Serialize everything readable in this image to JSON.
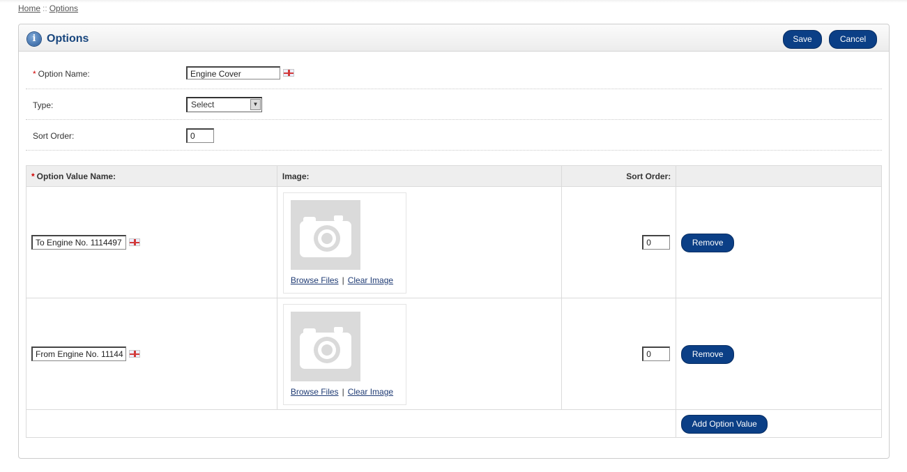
{
  "breadcrumb": {
    "home": "Home",
    "separator": "::",
    "current": "Options"
  },
  "panel": {
    "title": "Options",
    "save_label": "Save",
    "cancel_label": "Cancel"
  },
  "form": {
    "option_name": {
      "required_mark": "*",
      "label": "Option Name:",
      "value": "Engine Cover"
    },
    "type": {
      "label": "Type:",
      "selected": "Select"
    },
    "sort_order": {
      "label": "Sort Order:",
      "value": "0"
    }
  },
  "values_table": {
    "headers": {
      "required_mark": "*",
      "name": "Option Value Name:",
      "image": "Image:",
      "sort_order": "Sort Order:"
    },
    "rows": [
      {
        "name": "To Engine No. 1114497",
        "browse": "Browse Files",
        "clear": "Clear Image",
        "sort_order": "0",
        "remove_label": "Remove"
      },
      {
        "name": "From Engine No. 11144",
        "browse": "Browse Files",
        "clear": "Clear Image",
        "sort_order": "0",
        "remove_label": "Remove"
      }
    ],
    "link_separator": "|",
    "add_label": "Add Option Value"
  },
  "colors": {
    "button": "#0b3f86",
    "title": "#17457d",
    "required": "#d10000"
  }
}
